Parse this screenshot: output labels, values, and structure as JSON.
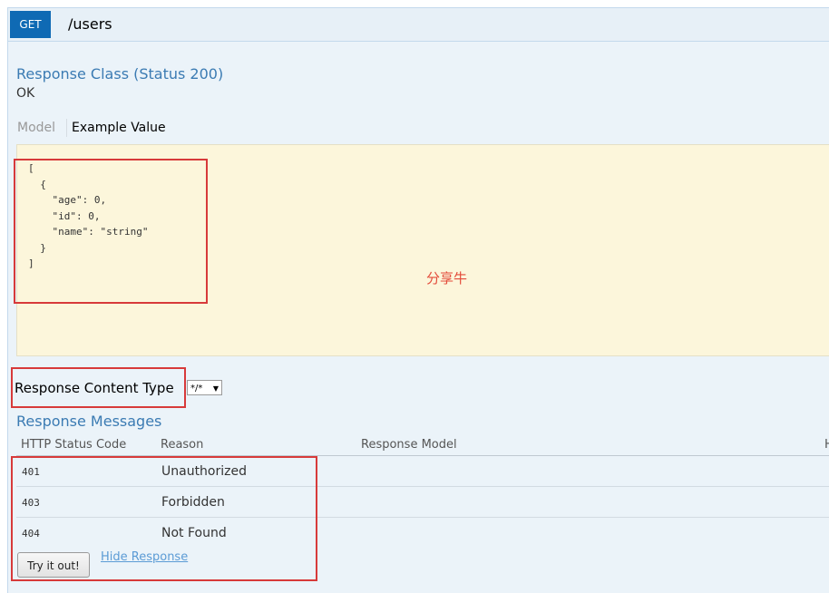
{
  "endpoint": {
    "method": "GET",
    "path": "/users"
  },
  "response_class": {
    "title": "Response Class (Status 200)",
    "status_text": "OK"
  },
  "tabs": {
    "model": "Model",
    "example_value": "Example Value"
  },
  "example_json": {
    "lines": [
      "[",
      "  {",
      "    \"age\": 0,",
      "    \"id\": 0,",
      "    \"name\": \"string\"",
      "  }",
      "]"
    ]
  },
  "watermark": "分享牛",
  "content_type": {
    "label": "Response Content Type",
    "selected": "*/*"
  },
  "response_messages": {
    "title": "Response Messages",
    "columns": [
      "HTTP Status Code",
      "Reason",
      "Response Model",
      "H"
    ],
    "rows": [
      {
        "code": "401",
        "reason": "Unauthorized"
      },
      {
        "code": "403",
        "reason": "Forbidden"
      },
      {
        "code": "404",
        "reason": "Not Found"
      }
    ]
  },
  "buttons": {
    "try_it_out": "Try it out!",
    "hide_response": "Hide Response"
  },
  "colors": {
    "method_badge": "#0f6ab4",
    "accent_title": "#3b7bb3",
    "highlight_box": "#d73a3a",
    "example_bg": "#fcf6db"
  }
}
